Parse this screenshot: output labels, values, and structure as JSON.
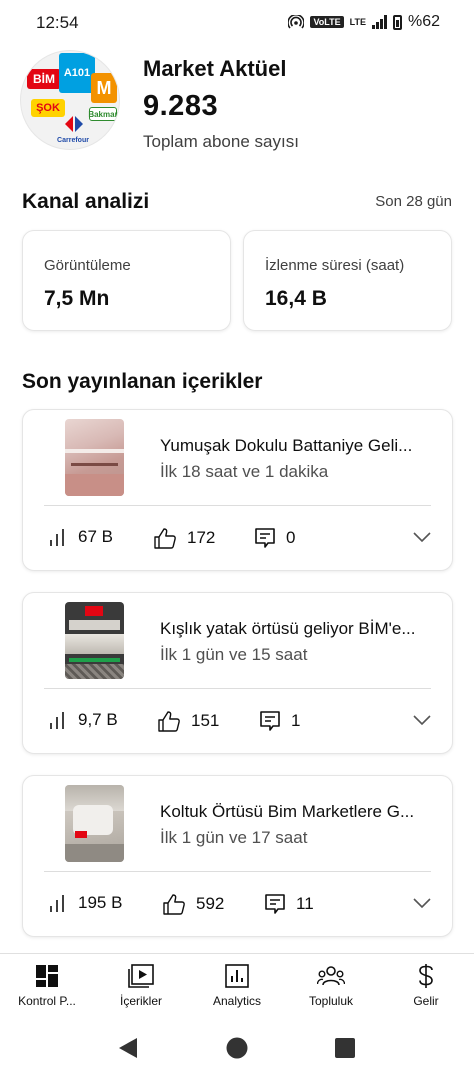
{
  "status_bar": {
    "time": "12:54",
    "volte": "VoLTE",
    "lte": "LTE",
    "battery": "%62"
  },
  "channel": {
    "name": "Market Aktüel",
    "subscriber_count": "9.283",
    "subscriber_label": "Toplam abone sayısı",
    "avatar_logos": [
      "BİM",
      "A101",
      "ŞOK",
      "M",
      "Carrefour",
      "Bakmar"
    ]
  },
  "analysis": {
    "title": "Kanal analizi",
    "period": "Son 28 gün",
    "metrics": [
      {
        "label": "Görüntüleme",
        "value": "7,5 Mn"
      },
      {
        "label": "İzlenme süresi (saat)",
        "value": "16,4 B"
      }
    ]
  },
  "recent": {
    "title": "Son yayınlanan içerikler",
    "items": [
      {
        "title": "Yumuşak Dokulu Battaniye Geli...",
        "age": "İlk 18 saat ve 1 dakika",
        "views": "67 B",
        "likes": "172",
        "comments": "0"
      },
      {
        "title": "Kışlık yatak örtüsü geliyor BİM'e...",
        "age": "İlk 1 gün ve 15 saat",
        "views": "9,7 B",
        "likes": "151",
        "comments": "1"
      },
      {
        "title": "Koltuk Örtüsü Bim Marketlere G...",
        "age": "İlk 1 gün ve 17 saat",
        "views": "195 B",
        "likes": "592",
        "comments": "11"
      }
    ]
  },
  "bottom_nav": {
    "items": [
      {
        "label": "Kontrol P...",
        "icon": "dashboard-icon"
      },
      {
        "label": "İçerikler",
        "icon": "content-icon"
      },
      {
        "label": "Analytics",
        "icon": "analytics-icon"
      },
      {
        "label": "Topluluk",
        "icon": "community-icon"
      },
      {
        "label": "Gelir",
        "icon": "earn-icon"
      }
    ]
  },
  "system_nav": {
    "icons": [
      "back-icon",
      "home-icon",
      "recents-icon"
    ]
  },
  "colors": {
    "text": "#0f0f0f",
    "secondary": "#505050",
    "border": "#e5e5e5",
    "bim_red": "#e30613",
    "a101_blue": "#00a0e1"
  }
}
